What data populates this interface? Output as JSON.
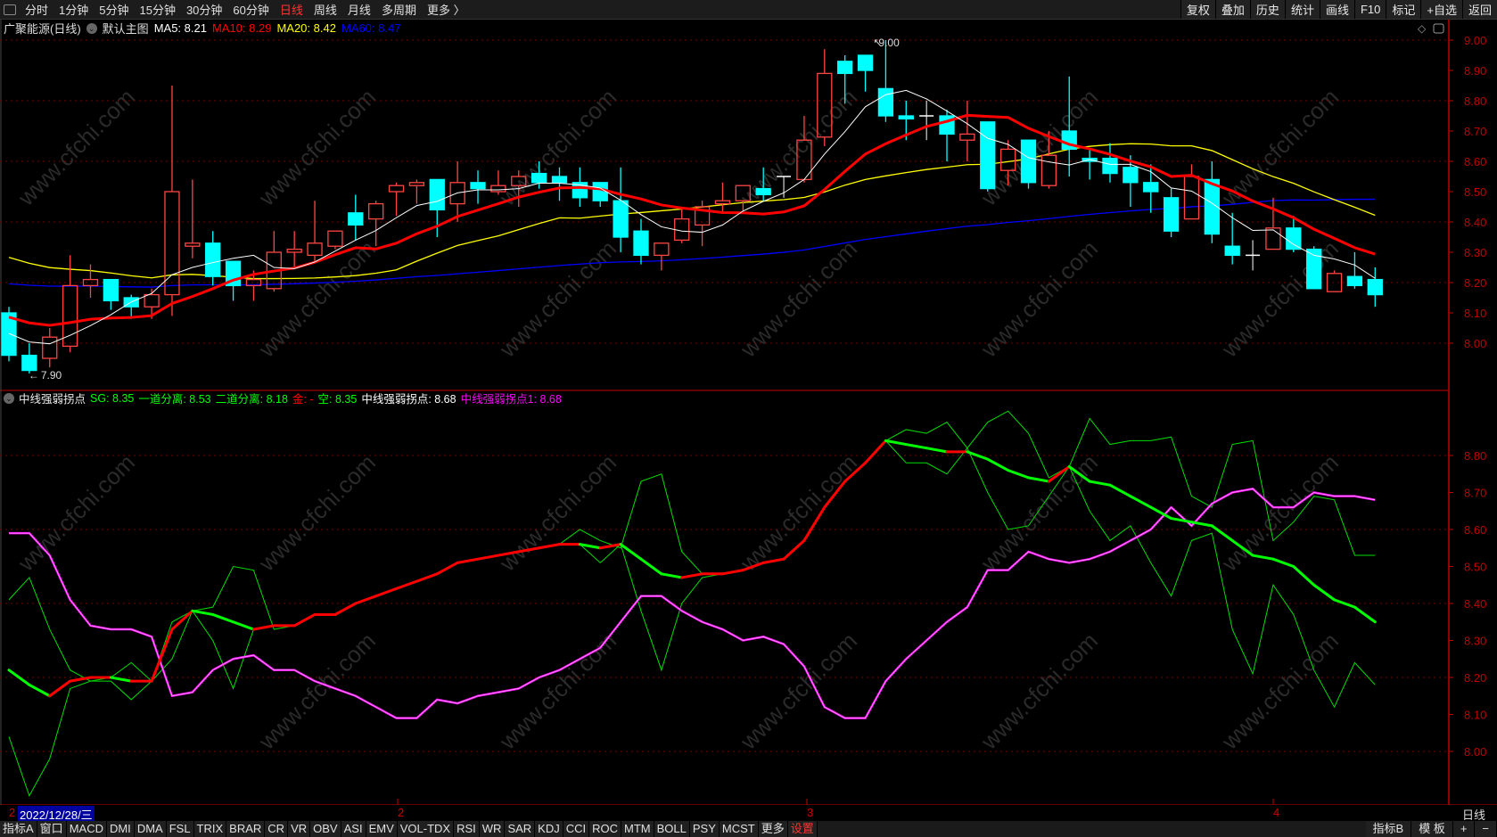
{
  "toolbar": {
    "periods": [
      "分时",
      "1分钟",
      "5分钟",
      "15分钟",
      "30分钟",
      "60分钟",
      "日线",
      "周线",
      "月线",
      "多周期",
      "更多 〉"
    ],
    "active_period": "日线",
    "buttons": [
      "复权",
      "叠加",
      "历史",
      "统计",
      "画线",
      "F10",
      "标记",
      "+自选",
      "返回"
    ]
  },
  "main_header": {
    "stock": "广聚能源(日线)",
    "template": "默认主图",
    "ma5": "MA5: 8.21",
    "ma10": "MA10: 8.29",
    "ma20": "MA20: 8.42",
    "ma60": "MA60: 8.47"
  },
  "colors": {
    "up": "#ff4444",
    "down": "#00ffff",
    "ma5": "#ffffff",
    "ma10": "#ff0000",
    "ma20": "#ffff00",
    "ma60": "#0000ff",
    "sg": "#00ff00",
    "sg_up": "#ff0000",
    "turn1": "#ff00ff",
    "axis": "#c00000"
  },
  "sub_header": {
    "name": "中线强弱拐点",
    "sg": "SG: 8.35",
    "line1": "一道分离: 8.53",
    "line2": "二道分离: 8.18",
    "gold": "金: -",
    "kong": "空: 8.35",
    "turn": "中线强弱拐点: 8.68",
    "turn1": "中线强弱拐点1: 8.68"
  },
  "chart_data": [
    {
      "type": "candlestick",
      "title": "广聚能源(日线)",
      "ylim": [
        7.9,
        9.0
      ],
      "yticks": [
        "9.00",
        "8.90",
        "8.80",
        "8.70",
        "8.60",
        "8.50",
        "8.40",
        "8.30",
        "8.20",
        "8.10",
        "8.00"
      ],
      "annotations": {
        "high": "9.00",
        "low": "7.90"
      },
      "ohlc": [
        [
          8.1,
          8.12,
          7.94,
          7.96
        ],
        [
          7.96,
          8.0,
          7.9,
          7.91
        ],
        [
          7.95,
          8.05,
          7.92,
          8.02
        ],
        [
          7.99,
          8.29,
          7.97,
          8.19
        ],
        [
          8.19,
          8.26,
          8.15,
          8.21
        ],
        [
          8.21,
          8.21,
          8.11,
          8.14
        ],
        [
          8.15,
          8.16,
          8.08,
          8.12
        ],
        [
          8.12,
          8.18,
          8.08,
          8.16
        ],
        [
          8.16,
          8.85,
          8.09,
          8.5
        ],
        [
          8.32,
          8.54,
          8.28,
          8.33
        ],
        [
          8.33,
          8.37,
          8.19,
          8.22
        ],
        [
          8.27,
          8.27,
          8.14,
          8.19
        ],
        [
          8.19,
          8.24,
          8.14,
          8.21
        ],
        [
          8.18,
          8.37,
          8.17,
          8.3
        ],
        [
          8.3,
          8.37,
          8.25,
          8.31
        ],
        [
          8.29,
          8.47,
          8.27,
          8.33
        ],
        [
          8.32,
          8.37,
          8.31,
          8.37
        ],
        [
          8.43,
          8.49,
          8.34,
          8.39
        ],
        [
          8.41,
          8.47,
          8.32,
          8.46
        ],
        [
          8.5,
          8.53,
          8.42,
          8.52
        ],
        [
          8.52,
          8.54,
          8.46,
          8.53
        ],
        [
          8.54,
          8.54,
          8.35,
          8.44
        ],
        [
          8.46,
          8.6,
          8.4,
          8.53
        ],
        [
          8.53,
          8.57,
          8.46,
          8.51
        ],
        [
          8.5,
          8.57,
          8.49,
          8.52
        ],
        [
          8.52,
          8.57,
          8.45,
          8.55
        ],
        [
          8.56,
          8.6,
          8.51,
          8.53
        ],
        [
          8.55,
          8.58,
          8.47,
          8.53
        ],
        [
          8.53,
          8.58,
          8.45,
          8.48
        ],
        [
          8.53,
          8.53,
          8.45,
          8.47
        ],
        [
          8.47,
          8.58,
          8.3,
          8.35
        ],
        [
          8.37,
          8.41,
          8.26,
          8.29
        ],
        [
          8.29,
          8.33,
          8.24,
          8.33
        ],
        [
          8.34,
          8.45,
          8.33,
          8.41
        ],
        [
          8.39,
          8.47,
          8.32,
          8.45
        ],
        [
          8.46,
          8.53,
          8.43,
          8.47
        ],
        [
          8.47,
          8.52,
          8.43,
          8.52
        ],
        [
          8.51,
          8.58,
          8.47,
          8.49
        ],
        [
          8.55,
          8.55,
          8.48,
          8.55
        ],
        [
          8.54,
          8.75,
          8.53,
          8.67
        ],
        [
          8.68,
          8.97,
          8.65,
          8.89
        ],
        [
          8.93,
          8.95,
          8.79,
          8.89
        ],
        [
          8.95,
          8.95,
          8.83,
          8.9
        ],
        [
          8.84,
          9.0,
          8.73,
          8.75
        ],
        [
          8.75,
          8.8,
          8.67,
          8.74
        ],
        [
          8.75,
          8.8,
          8.67,
          8.75
        ],
        [
          8.75,
          8.77,
          8.6,
          8.69
        ],
        [
          8.67,
          8.8,
          8.6,
          8.69
        ],
        [
          8.73,
          8.73,
          8.5,
          8.51
        ],
        [
          8.57,
          8.67,
          8.52,
          8.64
        ],
        [
          8.67,
          8.67,
          8.51,
          8.53
        ],
        [
          8.52,
          8.7,
          8.51,
          8.62
        ],
        [
          8.7,
          8.88,
          8.55,
          8.64
        ],
        [
          8.61,
          8.64,
          8.54,
          8.6
        ],
        [
          8.61,
          8.66,
          8.53,
          8.56
        ],
        [
          8.58,
          8.62,
          8.45,
          8.53
        ],
        [
          8.53,
          8.59,
          8.43,
          8.5
        ],
        [
          8.48,
          8.51,
          8.35,
          8.37
        ],
        [
          8.41,
          8.59,
          8.41,
          8.55
        ],
        [
          8.54,
          8.6,
          8.33,
          8.36
        ],
        [
          8.32,
          8.43,
          8.26,
          8.29
        ],
        [
          8.29,
          8.34,
          8.24,
          8.29
        ],
        [
          8.31,
          8.48,
          8.31,
          8.38
        ],
        [
          8.38,
          8.42,
          8.3,
          8.31
        ],
        [
          8.31,
          8.32,
          8.18,
          8.18
        ],
        [
          8.17,
          8.24,
          8.17,
          8.23
        ],
        [
          8.22,
          8.3,
          8.18,
          8.19
        ],
        [
          8.21,
          8.25,
          8.12,
          8.16
        ]
      ],
      "ma60_seed": 8.2
    },
    {
      "type": "line",
      "title": "中线强弱拐点",
      "ylim": [
        7.85,
        8.95
      ],
      "yticks": [
        "8.80",
        "8.70",
        "8.60",
        "8.50",
        "8.40",
        "8.30",
        "8.20",
        "8.10",
        "8.00"
      ],
      "series": [
        {
          "name": "SG",
          "values": [
            8.22,
            8.18,
            8.15,
            8.19,
            8.2,
            8.2,
            8.19,
            8.19,
            8.33,
            8.38,
            8.37,
            8.35,
            8.33,
            8.34,
            8.34,
            8.37,
            8.37,
            8.4,
            8.42,
            8.44,
            8.46,
            8.48,
            8.51,
            8.52,
            8.53,
            8.54,
            8.55,
            8.56,
            8.56,
            8.55,
            8.56,
            8.52,
            8.48,
            8.47,
            8.48,
            8.48,
            8.49,
            8.51,
            8.52,
            8.57,
            8.66,
            8.73,
            8.78,
            8.84,
            8.83,
            8.82,
            8.81,
            8.81,
            8.79,
            8.76,
            8.74,
            8.73,
            8.77,
            8.73,
            8.72,
            8.69,
            8.66,
            8.63,
            8.62,
            8.61,
            8.57,
            8.53,
            8.52,
            8.5,
            8.45,
            8.41,
            8.39,
            8.35
          ]
        },
        {
          "name": "一道分离",
          "values": [
            8.41,
            8.47,
            8.33,
            8.22,
            8.19,
            8.2,
            8.24,
            8.19,
            8.25,
            8.38,
            8.39,
            8.5,
            8.49,
            8.33,
            8.34,
            8.37,
            8.37,
            8.4,
            8.42,
            8.44,
            8.46,
            8.48,
            8.51,
            8.52,
            8.53,
            8.54,
            8.55,
            8.56,
            8.6,
            8.57,
            8.55,
            8.73,
            8.75,
            8.54,
            8.48,
            8.48,
            8.49,
            8.51,
            8.52,
            8.57,
            8.66,
            8.73,
            8.78,
            8.84,
            8.87,
            8.86,
            8.89,
            8.82,
            8.89,
            8.92,
            8.86,
            8.74,
            8.77,
            8.9,
            8.83,
            8.84,
            8.84,
            8.85,
            8.69,
            8.66,
            8.83,
            8.84,
            8.57,
            8.62,
            8.69,
            8.68,
            8.53,
            8.53
          ]
        },
        {
          "name": "二道分离",
          "values": [
            8.04,
            7.88,
            7.98,
            8.17,
            8.19,
            8.19,
            8.14,
            8.19,
            8.35,
            8.38,
            8.3,
            8.17,
            8.33,
            8.34,
            8.34,
            8.37,
            8.37,
            8.4,
            8.42,
            8.44,
            8.46,
            8.48,
            8.51,
            8.52,
            8.53,
            8.54,
            8.55,
            8.56,
            8.56,
            8.51,
            8.56,
            8.38,
            8.22,
            8.4,
            8.47,
            8.48,
            8.49,
            8.51,
            8.52,
            8.57,
            8.66,
            8.73,
            8.78,
            8.84,
            8.78,
            8.78,
            8.75,
            8.82,
            8.7,
            8.6,
            8.61,
            8.69,
            8.77,
            8.65,
            8.57,
            8.61,
            8.51,
            8.42,
            8.57,
            8.59,
            8.33,
            8.21,
            8.45,
            8.37,
            8.22,
            8.12,
            8.24,
            8.18
          ]
        },
        {
          "name": "中线强弱拐点1",
          "values": [
            8.59,
            8.59,
            8.53,
            8.41,
            8.34,
            8.33,
            8.33,
            8.31,
            8.15,
            8.16,
            8.22,
            8.25,
            8.26,
            8.22,
            8.22,
            8.19,
            8.17,
            8.15,
            8.12,
            8.09,
            8.09,
            8.14,
            8.13,
            8.15,
            8.16,
            8.17,
            8.2,
            8.22,
            8.25,
            8.28,
            8.35,
            8.42,
            8.42,
            8.38,
            8.35,
            8.33,
            8.3,
            8.31,
            8.29,
            8.23,
            8.12,
            8.09,
            8.09,
            8.19,
            8.25,
            8.3,
            8.35,
            8.39,
            8.49,
            8.49,
            8.54,
            8.52,
            8.51,
            8.52,
            8.54,
            8.57,
            8.6,
            8.66,
            8.61,
            8.67,
            8.7,
            8.71,
            8.66,
            8.66,
            8.7,
            8.69,
            8.69,
            8.68
          ]
        }
      ]
    }
  ],
  "date_bar": {
    "current": "2022/12/28/三",
    "first_month": "2",
    "months": [
      "2",
      "3",
      "4"
    ],
    "period": "日线"
  },
  "bottom_bar": {
    "tabs": [
      "指标A",
      "窗口",
      "MACD",
      "DMI",
      "DMA",
      "FSL",
      "TRIX",
      "BRAR",
      "CR",
      "VR",
      "OBV",
      "ASI",
      "EMV",
      "VOL-TDX",
      "RSI",
      "WR",
      "SAR",
      "KDJ",
      "CCI",
      "ROC",
      "MTM",
      "BOLL",
      "PSY",
      "MCST",
      "更多",
      "设置"
    ],
    "right": [
      "指标B",
      "模 板",
      "+",
      "−"
    ]
  },
  "watermark": "www.cfchi.com"
}
